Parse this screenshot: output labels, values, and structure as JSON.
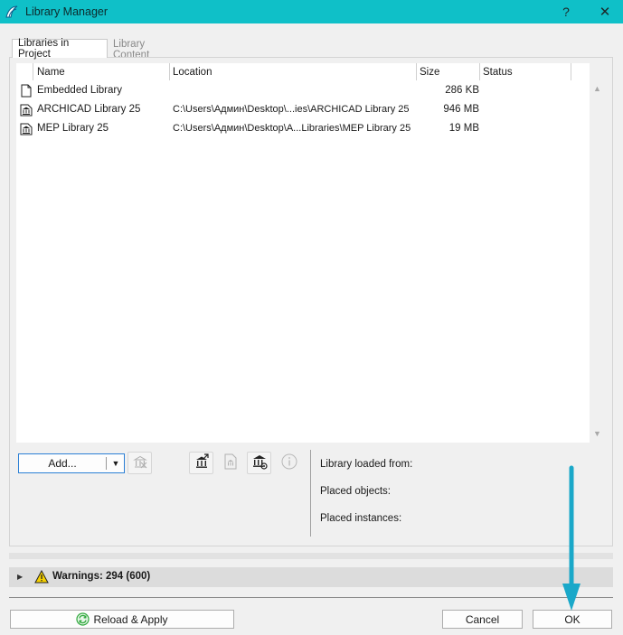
{
  "window": {
    "title": "Library Manager",
    "help_label": "?",
    "close_label": "✕"
  },
  "tabs": [
    {
      "label": "Libraries in Project",
      "active": true
    },
    {
      "label": "Library Content",
      "active": false
    }
  ],
  "table": {
    "columns": [
      "Name",
      "Location",
      "Size",
      "Status"
    ],
    "rows": [
      {
        "icon": "document-icon",
        "name": "Embedded Library",
        "location": "",
        "size": "286 KB",
        "status": ""
      },
      {
        "icon": "library-building-icon",
        "name": "ARCHICAD Library 25",
        "location": "C:\\Users\\Админ\\Desktop\\...ies\\ARCHICAD Library 25",
        "size": "946 MB",
        "status": ""
      },
      {
        "icon": "library-building-icon",
        "name": "MEP Library 25",
        "location": "C:\\Users\\Админ\\Desktop\\A...Libraries\\MEP Library 25",
        "size": "19 MB",
        "status": ""
      }
    ]
  },
  "toolbar": {
    "add_label": "Add...",
    "add_dropdown_icon": "chevron-down-icon",
    "buttons": [
      "remove-library-icon",
      "export-library-icon",
      "save-library-icon",
      "library-settings-icon",
      "info-icon"
    ]
  },
  "info": {
    "loaded_from_label": "Library loaded from:",
    "placed_objects_label": "Placed objects:",
    "placed_instances_label": "Placed instances:"
  },
  "warnings": {
    "label": "Warnings: 294 (600)",
    "icon": "warning-triangle-icon"
  },
  "footer": {
    "reload_label": "Reload & Apply",
    "cancel_label": "Cancel",
    "ok_label": "OK"
  },
  "colors": {
    "titlebar": "#0fc0c8",
    "annotation_arrow": "#1aa8c9",
    "focus_border": "#2b7fd5"
  }
}
